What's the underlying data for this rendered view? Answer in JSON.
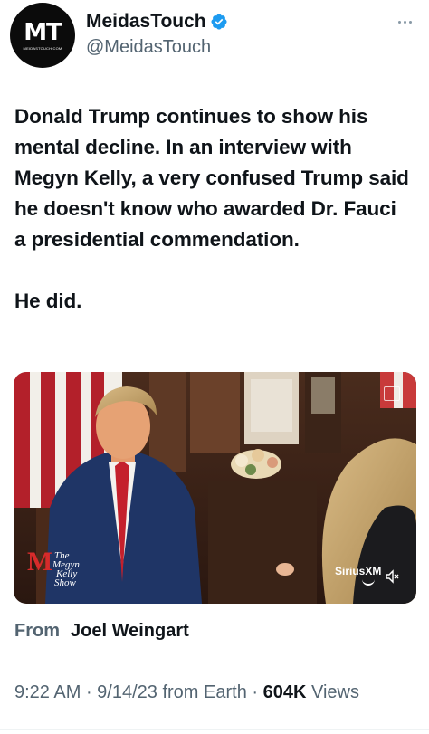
{
  "author": {
    "display_name": "MeidasTouch",
    "handle": "@MeidasTouch",
    "avatar_monogram": "MT",
    "avatar_site": "MEIDASTOUCH.COM",
    "verified_icon": "verified-badge-icon",
    "verified_color": "#1d9bf0"
  },
  "tweet": {
    "text_paragraph_1": "Donald Trump continues to show his mental decline. In an interview with Megyn Kelly, a very confused Trump said he doesn't know who awarded Dr. Fauci a presidential commendation.",
    "text_paragraph_2": "He did."
  },
  "media": {
    "show_logo_line1": "The",
    "show_logo_line2": "Megyn",
    "show_logo_line3": "Kelly",
    "show_logo_line4": "Show",
    "show_logo_mark": "M",
    "network_logo": "SiriusXM",
    "mute_icon": "speaker-muted-icon",
    "overlay_icon": "gif-badge-icon"
  },
  "source": {
    "label": "From",
    "name": "Joel Weingart"
  },
  "meta": {
    "time": "9:22 AM",
    "separator": " · ",
    "date": "9/14/23",
    "from_earth": " from Earth",
    "views_count": "604K",
    "views_label": " Views"
  },
  "more_icon": "more-dots-icon"
}
